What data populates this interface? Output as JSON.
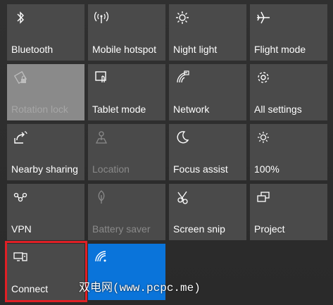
{
  "tiles": [
    {
      "label": "Bluetooth",
      "icon": "bluetooth-icon",
      "state": "normal"
    },
    {
      "label": "Mobile hotspot",
      "icon": "hotspot-icon",
      "state": "normal"
    },
    {
      "label": "Night light",
      "icon": "sun-icon",
      "state": "normal"
    },
    {
      "label": "Flight mode",
      "icon": "airplane-icon",
      "state": "normal"
    },
    {
      "label": "Rotation lock",
      "icon": "rotation-lock-icon",
      "state": "dim"
    },
    {
      "label": "Tablet mode",
      "icon": "tablet-icon",
      "state": "normal"
    },
    {
      "label": "Network",
      "icon": "network-icon",
      "state": "normal"
    },
    {
      "label": "All settings",
      "icon": "gear-icon",
      "state": "normal"
    },
    {
      "label": "Nearby sharing",
      "icon": "share-icon",
      "state": "normal"
    },
    {
      "label": "Location",
      "icon": "location-icon",
      "state": "disabled"
    },
    {
      "label": "Focus assist",
      "icon": "moon-icon",
      "state": "normal"
    },
    {
      "label": "100%",
      "icon": "brightness-icon",
      "state": "normal"
    },
    {
      "label": "VPN",
      "icon": "vpn-icon",
      "state": "normal"
    },
    {
      "label": "Battery saver",
      "icon": "leaf-icon",
      "state": "disabled"
    },
    {
      "label": "Screen snip",
      "icon": "screen-snip-icon",
      "state": "normal"
    },
    {
      "label": "Project",
      "icon": "project-icon",
      "state": "normal"
    },
    {
      "label": "Connect",
      "icon": "connect-icon",
      "state": "normal"
    },
    {
      "label": "",
      "icon": "wifi-icon",
      "state": "active"
    }
  ],
  "watermark": "双电网(www.pcpc.me)",
  "colors": {
    "tile": "#4a4a4a",
    "tile_dim": "#8a8a8a",
    "tile_active": "#0a74da",
    "highlight": "#e01f25"
  }
}
